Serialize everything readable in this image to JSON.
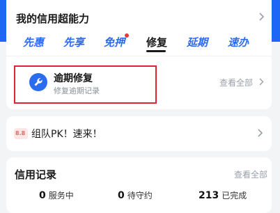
{
  "credit_power": {
    "title": "我的信用超能力",
    "tabs": [
      {
        "label": "先惠"
      },
      {
        "label": "先享"
      },
      {
        "label": "免押"
      },
      {
        "label": "修复"
      },
      {
        "label": "延期"
      },
      {
        "label": "速办"
      }
    ],
    "active_tab_index": 3,
    "repair": {
      "title": "逾期修复",
      "subtitle": "修复逾期记录",
      "view_all": "查看全部"
    }
  },
  "team_banner": {
    "badge": "8.8",
    "text": "组队PK！速来！"
  },
  "credit_record": {
    "title": "信用记录",
    "view_all": "查看全部",
    "stats": [
      {
        "count": "0",
        "label": "服务中"
      },
      {
        "count": "0",
        "label": "待守约"
      },
      {
        "count": "213",
        "label": "已完成"
      }
    ]
  },
  "colors": {
    "brand_blue": "#1e67f5",
    "highlight_red": "#e0232f",
    "badge_dot": "#e53935"
  }
}
